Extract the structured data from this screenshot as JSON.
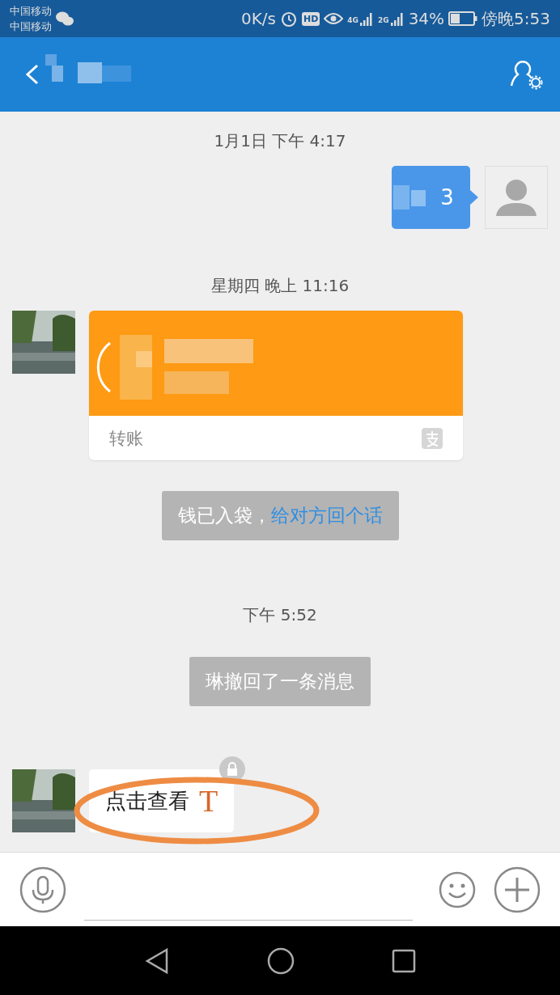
{
  "status_bar": {
    "carrier_lines": [
      "中国移动",
      "中国移动"
    ],
    "speed": "0K/s",
    "hd": "HD",
    "network_4g": "4G",
    "network_2g": "2G",
    "battery": "34%",
    "time": "傍晚5:53"
  },
  "messages": [
    {
      "kind": "time",
      "text": "1月1日 下午 4:17"
    },
    {
      "kind": "outgoing",
      "text": "3"
    },
    {
      "kind": "time",
      "text": "星期四 晚上 11:16"
    },
    {
      "kind": "transfer",
      "label": "转账"
    },
    {
      "kind": "notice",
      "text": "钱已入袋，",
      "link": "给对方回个话"
    },
    {
      "kind": "time",
      "text": "下午 5:52"
    },
    {
      "kind": "notice",
      "text": "琳撤回了一条消息"
    },
    {
      "kind": "incoming",
      "text": "点击查看",
      "mark": "T",
      "locked": true
    }
  ]
}
